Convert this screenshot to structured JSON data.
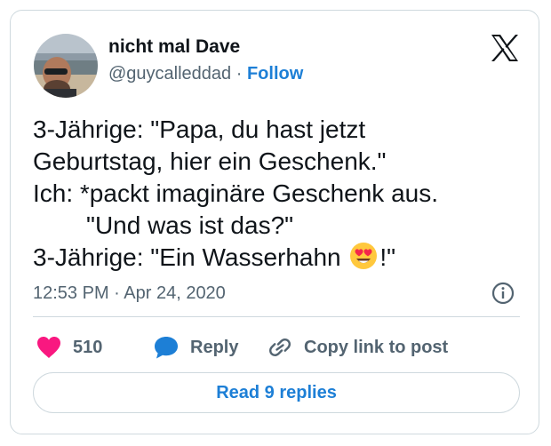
{
  "author": {
    "display_name": "nicht mal Dave",
    "handle": "@guycalleddad",
    "separator": " · ",
    "follow_label": "Follow"
  },
  "tweet": {
    "lines": [
      "3-Jährige: \"Papa, du hast jetzt",
      "Geburtstag, hier ein Geschenk.\"",
      "Ich: *packt imaginäre Geschenk aus.",
      "\"Und was ist das?\""
    ],
    "last_line_before_emoji": "3-Jährige: \"Ein Wasserhahn ",
    "emoji_name": "heart-eyes-emoji",
    "last_line_after_emoji": "!\""
  },
  "timestamp": "12:53 PM · Apr 24, 2020",
  "actions": {
    "like_count": "510",
    "reply_label": "Reply",
    "copy_label": "Copy link to post"
  },
  "read_replies_label": "Read 9 replies",
  "colors": {
    "accent": "#1d7fd6",
    "like": "#f91880",
    "secondary_text": "#536471",
    "border": "#cfd9de"
  },
  "icons": [
    "x-logo-icon",
    "info-icon",
    "heart-icon",
    "reply-bubble-icon",
    "link-icon"
  ]
}
